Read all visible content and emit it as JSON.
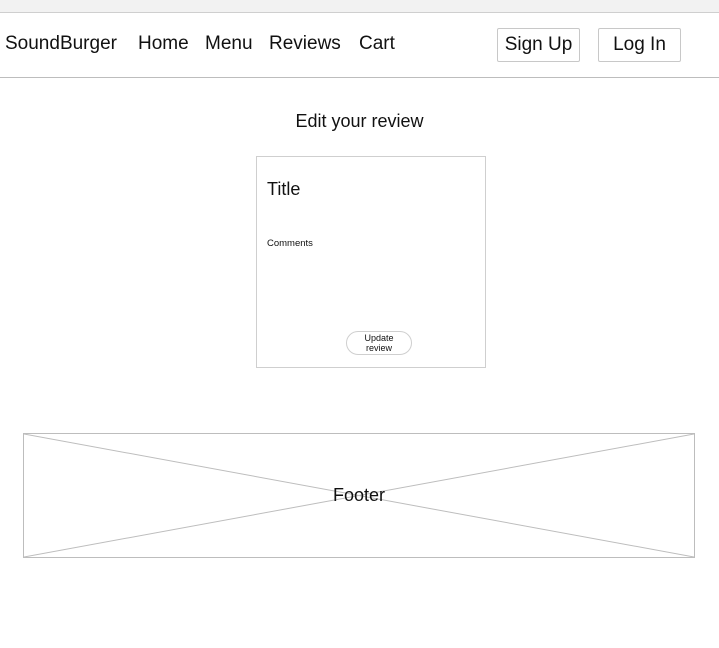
{
  "nav": {
    "brand": "SoundBurger",
    "links": [
      "Home",
      "Menu",
      "Reviews",
      "Cart"
    ],
    "signup_label": "Sign Up",
    "login_label": "Log In"
  },
  "page": {
    "title": "Edit your review"
  },
  "form": {
    "title_label": "Title",
    "comments_label": "Comments",
    "submit_label": "Update review"
  },
  "footer": {
    "label": "Footer"
  }
}
